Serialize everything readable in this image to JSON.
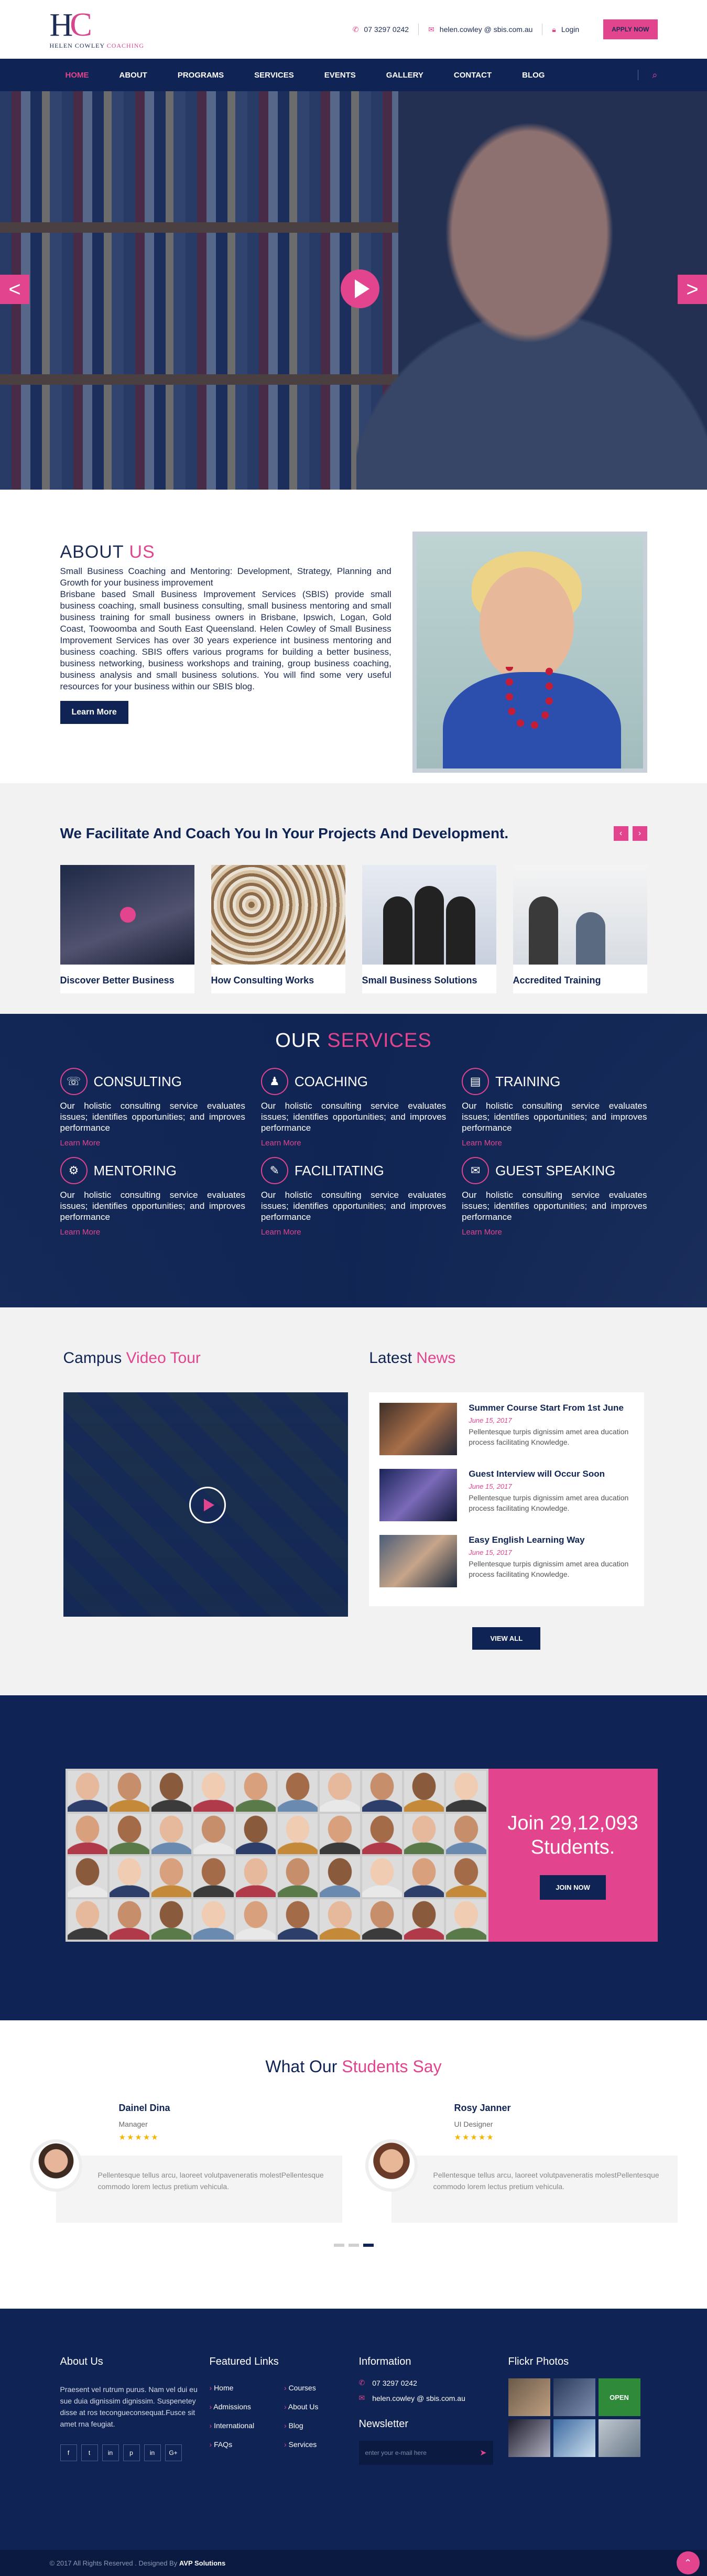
{
  "logo": {
    "mark_h": "H",
    "mark_c": "C",
    "text_main": "HELEN COWLEY",
    "text_accent": "COACHING"
  },
  "top_contact": {
    "phone": "07 3297 0242",
    "email": "helen.cowley @ sbis.com.au",
    "login": "Login",
    "apply": "APPLY NOW"
  },
  "nav": {
    "items": [
      "HOME",
      "ABOUT",
      "PROGRAMS",
      "SERVICES",
      "EVENTS",
      "GALLERY",
      "CONTACT",
      "BLOG"
    ],
    "active": "HOME"
  },
  "hero": {
    "prev": "<",
    "next": ">"
  },
  "about": {
    "title": "ABOUT",
    "title_accent": "US",
    "p1": "Small Business Coaching and Mentoring: Development, Strategy, Planning and Growth for your business improvement",
    "p2": "Brisbane based Small Business Improvement Services (SBIS) provide small business coaching, small business consulting, small business mentoring  and small business training for small business owners in Brisbane, Ipswich, Logan, Gold Coast, Toowoomba and South East Queensland. Helen Cowley of Small Business Improvement Services has over 30 years experience int business mentoring and business coaching.  SBIS offers various programs for building a better business, business networking, business workshops and training, group business coaching, business analysis and small business solutions.  You will find some very useful resources for your business within our SBIS blog.",
    "button": "Learn More"
  },
  "facilitate": {
    "title": "We Facilitate And Coach You In Your Projects And Development.",
    "prev": "‹",
    "next": "›",
    "cards": [
      "Discover Better Business",
      "How Consulting Works",
      "Small Business Solutions",
      "Accredited Training"
    ]
  },
  "services": {
    "title": "OUR",
    "title_accent": "SERVICES",
    "items": [
      {
        "title": "CONSULTING",
        "icon": "consulting-icon",
        "desc": "Our holistic consulting service evaluates issues; identifies opportunities; and improves performance",
        "more": "Learn More"
      },
      {
        "title": "COACHING",
        "icon": "coaching-icon",
        "desc": "Our holistic consulting service evaluates issues; identifies opportunities; and improves performance",
        "more": "Learn More"
      },
      {
        "title": "TRAINING",
        "icon": "training-icon",
        "desc": "Our holistic consulting service evaluates issues; identifies opportunities; and improves performance",
        "more": "Learn More"
      },
      {
        "title": "MENTORING",
        "icon": "mentoring-icon",
        "desc": "Our holistic consulting service evaluates issues; identifies opportunities; and improves performance",
        "more": "Learn More"
      },
      {
        "title": "FACILITATING",
        "icon": "facilitating-icon",
        "desc": "Our holistic consulting service evaluates issues; identifies opportunities; and improves performance",
        "more": "Learn More"
      },
      {
        "title": "GUEST SPEAKING",
        "icon": "speech-icon",
        "desc": "Our holistic consulting service evaluates issues; identifies opportunities; and improves performance",
        "more": "Learn More"
      }
    ]
  },
  "video": {
    "title": "Campus",
    "title_accent": "Video Tour"
  },
  "news": {
    "title": "Latest",
    "title_accent": "News",
    "items": [
      {
        "title": "Summer Course Start From 1st June",
        "date": "June 15, 2017",
        "desc": "Pellentesque turpis dignissim amet area ducation process facilitating Knowledge."
      },
      {
        "title": "Guest Interview will Occur Soon",
        "date": "June 15, 2017",
        "desc": "Pellentesque turpis dignissim amet area ducation process facilitating Knowledge."
      },
      {
        "title": "Easy English Learning Way",
        "date": "June 15, 2017",
        "desc": "Pellentesque turpis dignissim amet area ducation process facilitating Knowledge."
      }
    ],
    "view_all": "VIEW ALL"
  },
  "students": {
    "line1": "Join 29,12,093",
    "line2": "Students.",
    "button": "JOIN NOW"
  },
  "testimonials": {
    "title": "What Our",
    "title_accent": "Students Say",
    "items": [
      {
        "name": "Dainel Dina",
        "role": "Manager",
        "stars": "★★★★★",
        "text": "Pellentesque tellus arcu, laoreet volutpaveneratis molestPellentesque commodo lorem lectus pretium vehicula."
      },
      {
        "name": "Rosy Janner",
        "role": "UI Designer",
        "stars": "★★★★★",
        "text": "Pellentesque tellus arcu, laoreet volutpaveneratis molestPellentesque commodo lorem lectus pretium vehicula."
      }
    ]
  },
  "footer": {
    "about_title": "About Us",
    "about_text": "Praesent vel rutrum purus. Nam vel dui eu sue duia dignissim dignissim. Suspenetey disse at ros tecongueconsequat.Fusce sit amet rna feugiat.",
    "social": [
      "f",
      "t",
      "in",
      "p",
      "in",
      "G+"
    ],
    "links_title": "Featured Links",
    "links": [
      "Home",
      "Courses",
      "Admissions",
      "About Us",
      "International",
      "Blog",
      "FAQs",
      "Services"
    ],
    "info_title": "Information",
    "phone": "07 3297 0242",
    "email": "helen.cowley @ sbis.com.au",
    "newsletter_title": "Newsletter",
    "newsletter_placeholder": "enter your e-mail here",
    "flickr_title": "Flickr Photos",
    "flickr_tag": "OPEN",
    "copyright": "© 2017 All Rights Reserved . Designed By",
    "designer": "AVP Solutions"
  }
}
